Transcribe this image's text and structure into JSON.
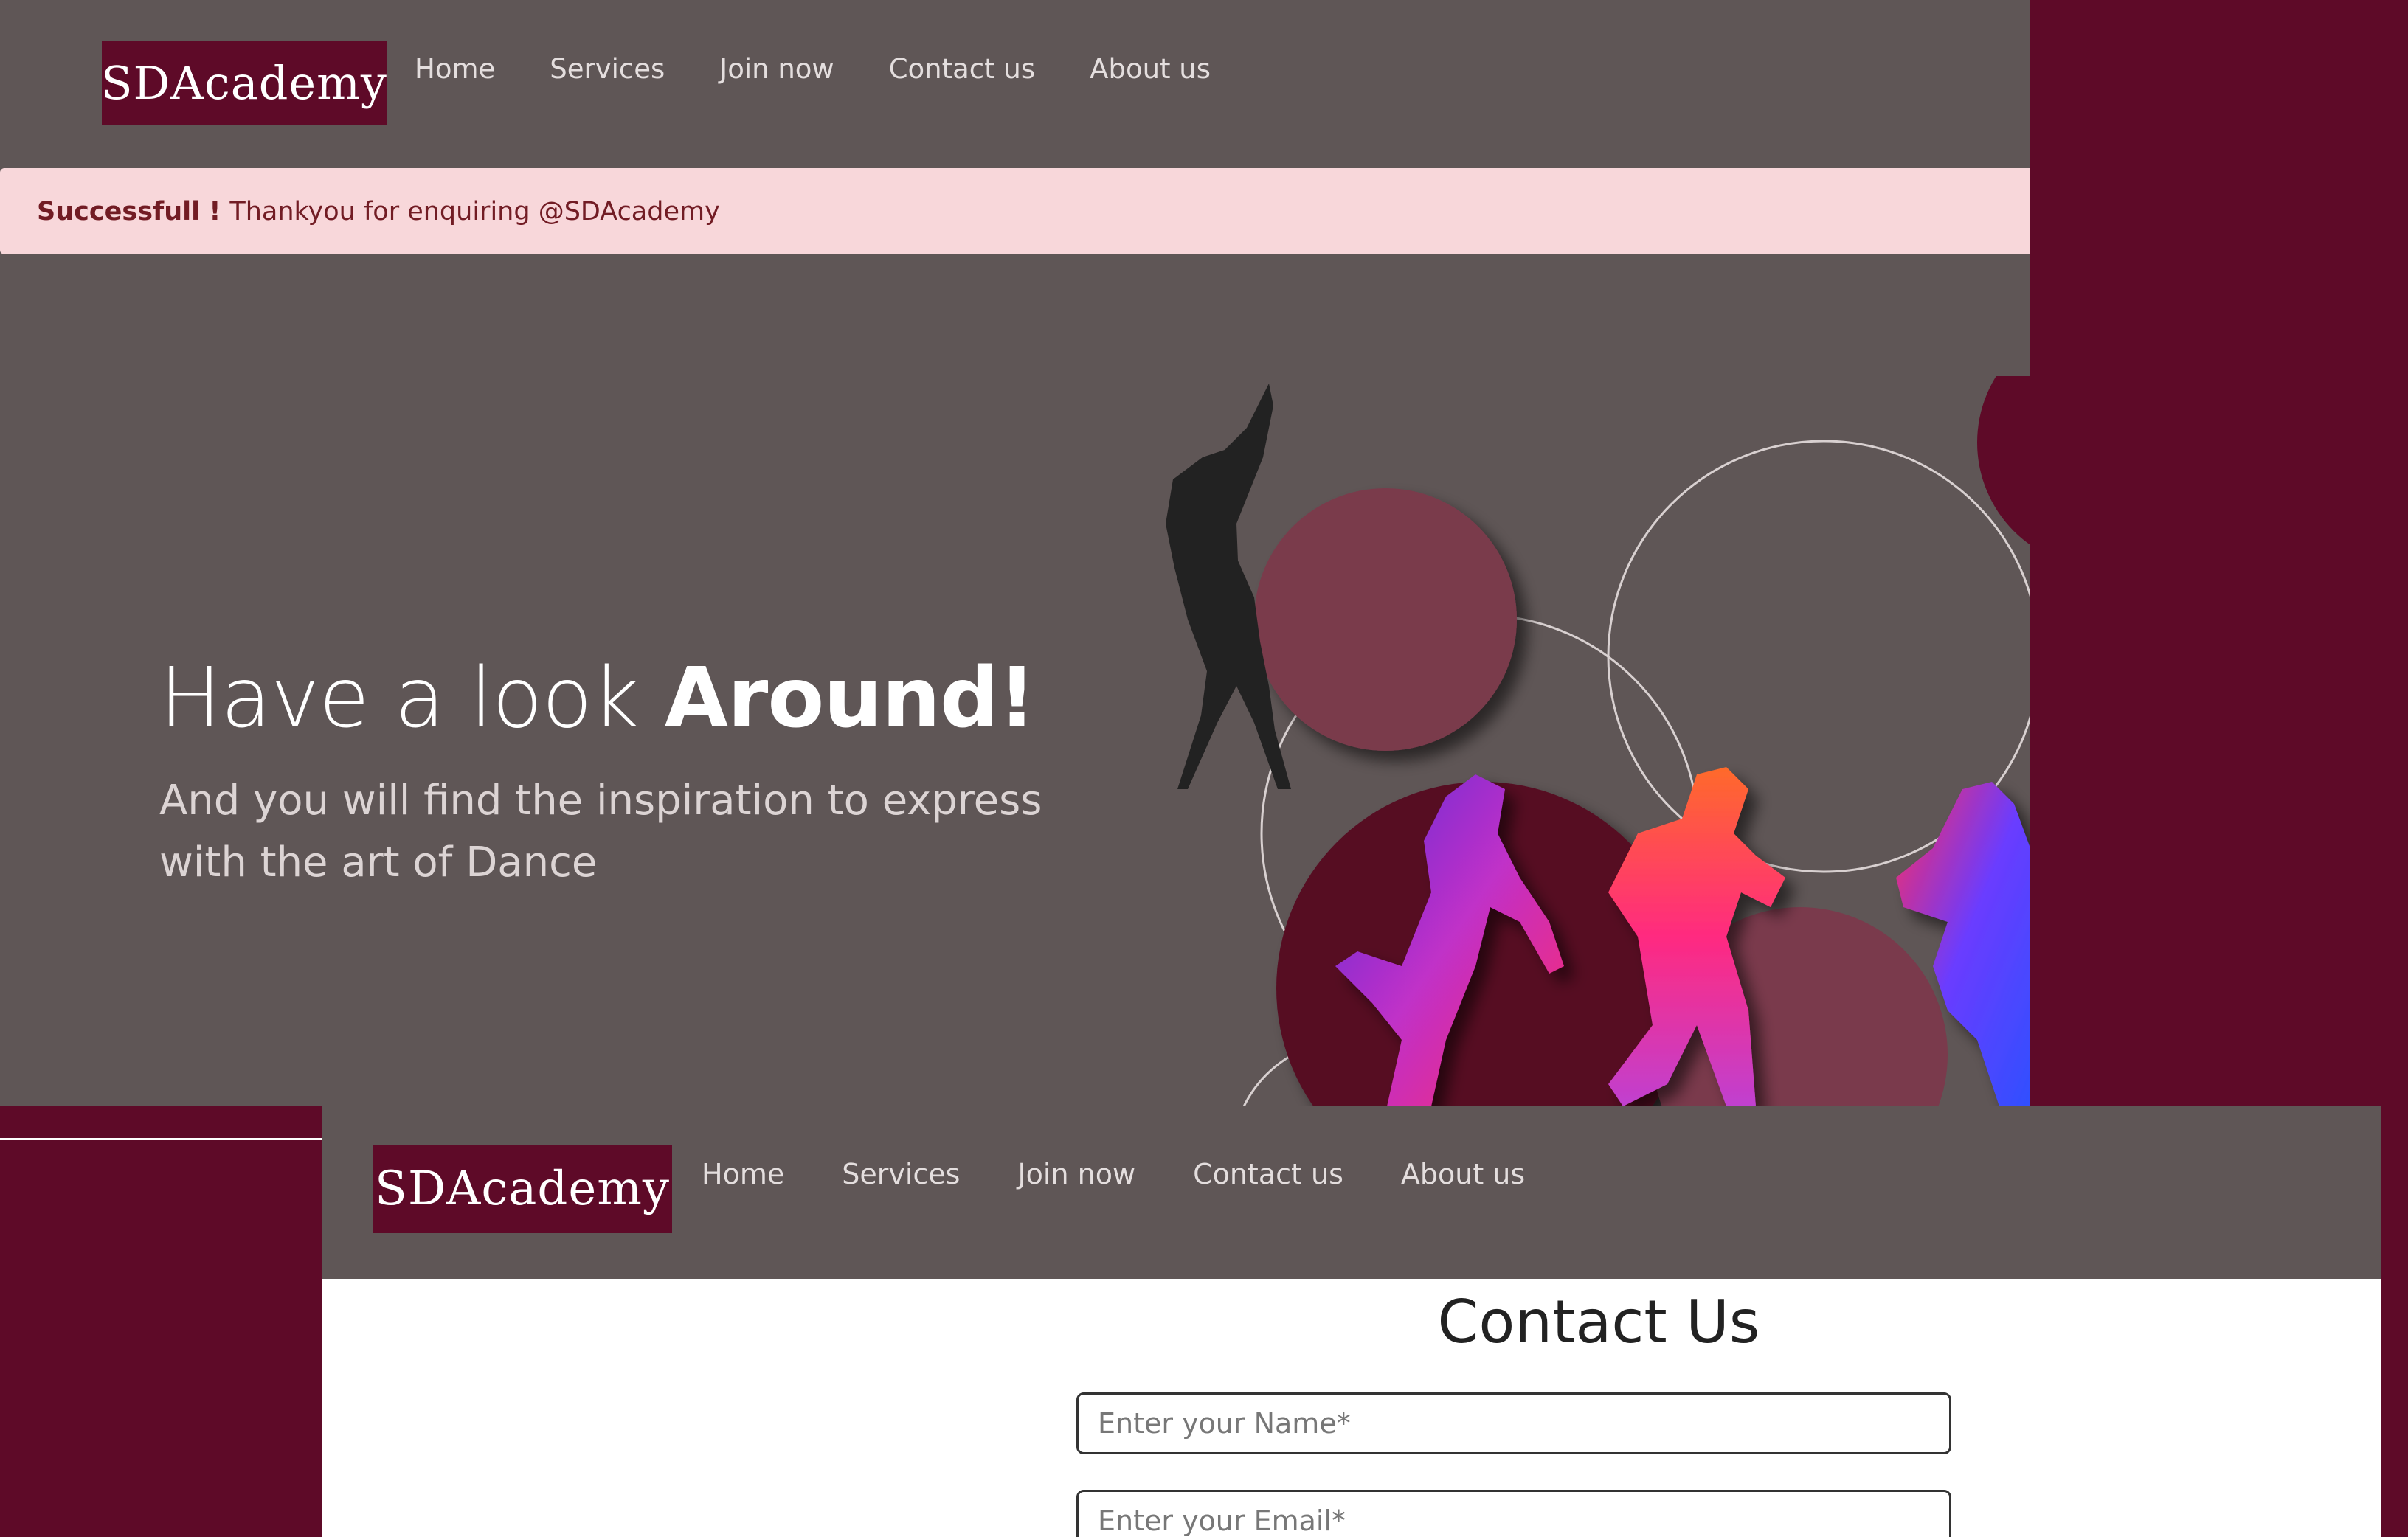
{
  "top_window": {
    "logo": "SDAcademy",
    "nav": [
      "Home",
      "Services",
      "Join now",
      "Contact us",
      "About us"
    ],
    "alert": {
      "strong": "Successfull !",
      "message": "Thankyou for enquiring @SDAcademy"
    },
    "hero": {
      "heading_light": "Have a look ",
      "heading_bold": "Around!",
      "subtitle": "And you will find the inspiration to express with the art of Dance"
    }
  },
  "bottom_window": {
    "logo": "SDAcademy",
    "nav": [
      "Home",
      "Services",
      "Join now",
      "Contact us",
      "About us"
    ],
    "contact": {
      "title": "Contact Us",
      "name_placeholder": "Enter your Name*",
      "email_placeholder": "Enter your Email*"
    }
  },
  "colors": {
    "brand": "#5e0a28",
    "nav_bg": "#5f5656",
    "alert_bg": "#f8d7da",
    "alert_text": "#721c24"
  },
  "icons": [
    "dancer-silhouette-icon",
    "dancers-illustration-icon"
  ]
}
